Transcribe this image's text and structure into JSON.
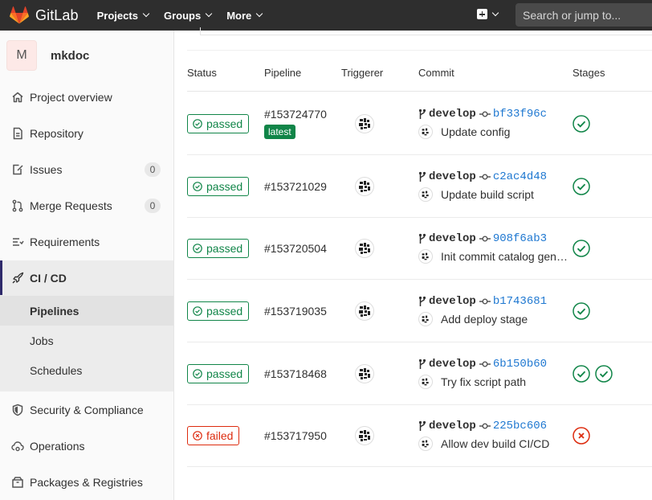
{
  "navbar": {
    "brand": "GitLab",
    "menu": [
      "Projects",
      "Groups",
      "More"
    ],
    "search_placeholder": "Search or jump to..."
  },
  "sidebar": {
    "project_initial": "M",
    "project_name": "mkdoc",
    "items": [
      {
        "label": "Project overview",
        "icon": "home-icon"
      },
      {
        "label": "Repository",
        "icon": "doc-icon"
      },
      {
        "label": "Issues",
        "icon": "issues-icon",
        "count": "0"
      },
      {
        "label": "Merge Requests",
        "icon": "merge-request-icon",
        "count": "0"
      },
      {
        "label": "Requirements",
        "icon": "requirements-icon"
      },
      {
        "label": "CI / CD",
        "icon": "rocket-icon"
      },
      {
        "label": "Security & Compliance",
        "icon": "shield-icon"
      },
      {
        "label": "Operations",
        "icon": "cloud-gear-icon"
      },
      {
        "label": "Packages & Registries",
        "icon": "package-icon"
      }
    ],
    "cicd_sub": [
      "Pipelines",
      "Jobs",
      "Schedules"
    ]
  },
  "table": {
    "headers": [
      "Status",
      "Pipeline",
      "Triggerer",
      "Commit",
      "Stages"
    ],
    "latest_label": "latest",
    "rows": [
      {
        "status": "passed",
        "id": "#153724770",
        "latest": true,
        "branch": "develop",
        "sha": "bf33f96c",
        "message": "Update config",
        "stages": [
          "success"
        ]
      },
      {
        "status": "passed",
        "id": "#153721029",
        "latest": false,
        "branch": "develop",
        "sha": "c2ac4d48",
        "message": "Update build script",
        "stages": [
          "success"
        ]
      },
      {
        "status": "passed",
        "id": "#153720504",
        "latest": false,
        "branch": "develop",
        "sha": "908f6ab3",
        "message": "Init commit catalog gen…",
        "stages": [
          "success"
        ]
      },
      {
        "status": "passed",
        "id": "#153719035",
        "latest": false,
        "branch": "develop",
        "sha": "b1743681",
        "message": "Add deploy stage",
        "stages": [
          "success"
        ]
      },
      {
        "status": "passed",
        "id": "#153718468",
        "latest": false,
        "branch": "develop",
        "sha": "6b150b60",
        "message": "Try fix script path",
        "stages": [
          "success",
          "success"
        ]
      },
      {
        "status": "failed",
        "id": "#153717950",
        "latest": false,
        "branch": "develop",
        "sha": "225bc606",
        "message": "Allow dev build CI/CD",
        "stages": [
          "failed"
        ]
      }
    ]
  },
  "colors": {
    "navbar_bg": "#2e2e2e",
    "success": "#108548",
    "failed": "#dd2b0e",
    "link": "#1f78d1",
    "active_indicator": "#2f2a6b"
  }
}
